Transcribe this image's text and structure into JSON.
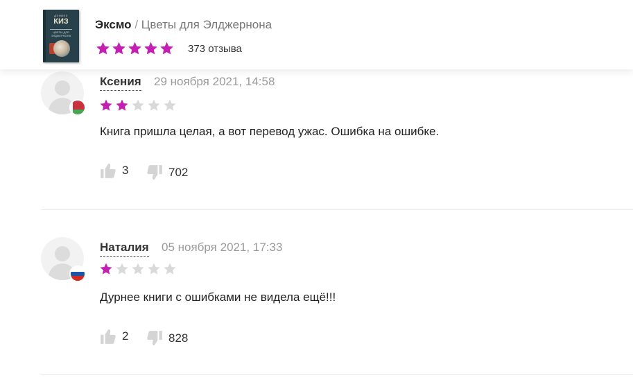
{
  "header": {
    "publisher": "Эксмо",
    "separator": "/",
    "book_title": "Цветы для Элджернона",
    "rating_stars": 5,
    "reviews_count": "373 отзыва",
    "cover": {
      "author": "ДЭНИЕЛ",
      "name": "КИЗ",
      "title": "ЦВЕТЫ ДЛЯ ЭЛДЖЕРНОНА"
    }
  },
  "colors": {
    "star_active": "#c41eb3",
    "star_inactive": "#d9d9d9",
    "thumb": "#d4d4d4"
  },
  "reviews": [
    {
      "author": "Ксения",
      "date": "29 ноября 2021, 14:58",
      "rating": 2,
      "text": "Книга пришла целая, а вот перевод ужас. Ошибка на ошибке.",
      "likes": "3",
      "dislikes": "702",
      "country_flag": "belarus-flag"
    },
    {
      "author": "Наталия",
      "date": "05 ноября 2021, 17:33",
      "rating": 1,
      "text": "Дурнее книги с ошибками не видела ещё!!!",
      "likes": "2",
      "dislikes": "828",
      "country_flag": "russia-flag"
    }
  ]
}
